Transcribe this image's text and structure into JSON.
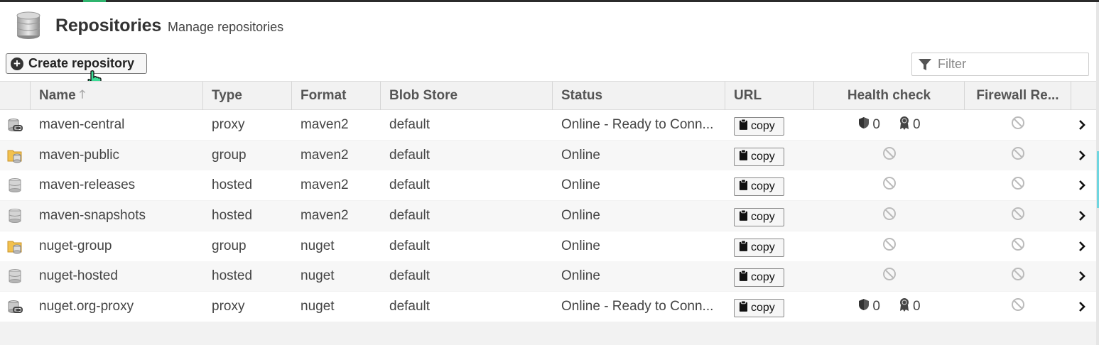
{
  "page": {
    "title": "Repositories",
    "subtitle": "Manage repositories"
  },
  "toolbar": {
    "create_label": "Create repository",
    "filter_placeholder": "Filter"
  },
  "columns": {
    "name": "Name",
    "type": "Type",
    "format": "Format",
    "blob_store": "Blob Store",
    "status": "Status",
    "url": "URL",
    "health_check": "Health check",
    "firewall": "Firewall Re..."
  },
  "copy_label": "copy",
  "rows": [
    {
      "icon": "proxy-repo-icon",
      "name": "maven-central",
      "type": "proxy",
      "format": "maven2",
      "blob": "default",
      "status": "Online - Ready to Conn...",
      "health": {
        "security": "0",
        "license": "0"
      }
    },
    {
      "icon": "group-repo-icon",
      "name": "maven-public",
      "type": "group",
      "format": "maven2",
      "blob": "default",
      "status": "Online",
      "health": null
    },
    {
      "icon": "hosted-repo-icon",
      "name": "maven-releases",
      "type": "hosted",
      "format": "maven2",
      "blob": "default",
      "status": "Online",
      "health": null
    },
    {
      "icon": "hosted-repo-icon",
      "name": "maven-snapshots",
      "type": "hosted",
      "format": "maven2",
      "blob": "default",
      "status": "Online",
      "health": null
    },
    {
      "icon": "group-repo-icon",
      "name": "nuget-group",
      "type": "group",
      "format": "nuget",
      "blob": "default",
      "status": "Online",
      "health": null
    },
    {
      "icon": "hosted-repo-icon",
      "name": "nuget-hosted",
      "type": "hosted",
      "format": "nuget",
      "blob": "default",
      "status": "Online",
      "health": null
    },
    {
      "icon": "proxy-repo-icon",
      "name": "nuget.org-proxy",
      "type": "proxy",
      "format": "nuget",
      "blob": "default",
      "status": "Online - Ready to Conn...",
      "health": {
        "security": "0",
        "license": "0"
      }
    }
  ]
}
